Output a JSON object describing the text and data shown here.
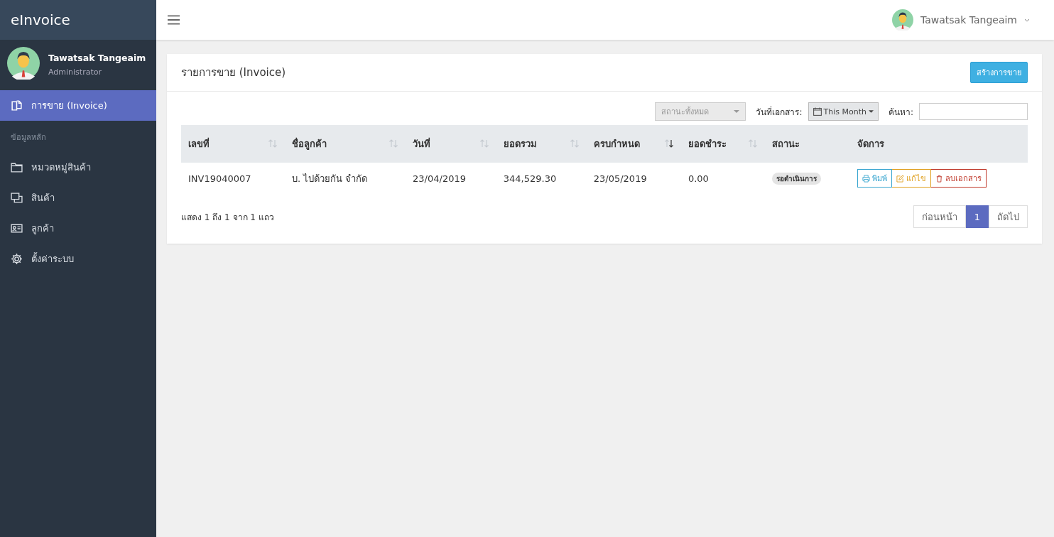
{
  "brand": "eInvoice",
  "user": {
    "name": "Tawatsak Tangeaim",
    "role": "Administrator"
  },
  "sidebar": {
    "items": [
      {
        "kind": "link",
        "label": "การขาย (Invoice)",
        "selected": true
      },
      {
        "kind": "header",
        "label": "ข้อมูลหลัก"
      },
      {
        "kind": "link",
        "label": "หมวดหมู่สินค้า",
        "selected": false
      },
      {
        "kind": "link",
        "label": "สินค้า",
        "selected": false
      },
      {
        "kind": "link",
        "label": "ลูกค้า",
        "selected": false
      },
      {
        "kind": "link",
        "label": "ตั้งค่าระบบ",
        "selected": false
      }
    ]
  },
  "topbar": {
    "user_name": "Tawatsak Tangeaim"
  },
  "panel": {
    "title": "รายการขาย (Invoice)",
    "create_button": "สร้างการขาย",
    "filters": {
      "status_placeholder": "สถานะทั้งหมด",
      "date_label": "วันที่เอกสาร:",
      "date_button": "This Month",
      "search_label": "ค้นหา:"
    },
    "table": {
      "columns": [
        {
          "label": "เลขที่",
          "sortable": true,
          "sorted": false
        },
        {
          "label": "ชื่อลูกค้า",
          "sortable": true,
          "sorted": false
        },
        {
          "label": "วันที่",
          "sortable": true,
          "sorted": false
        },
        {
          "label": "ยอดรวม",
          "sortable": true,
          "sorted": false
        },
        {
          "label": "ครบกำหนด",
          "sortable": true,
          "sorted": true
        },
        {
          "label": "ยอดชำระ",
          "sortable": true,
          "sorted": false
        },
        {
          "label": "สถานะ",
          "sortable": false
        },
        {
          "label": "จัดการ",
          "sortable": false
        }
      ],
      "rows": [
        {
          "cells": [
            "INV19040007",
            "บ. ไปด้วยกัน จำกัด",
            "23/04/2019",
            "344,529.30",
            "23/05/2019",
            "0.00"
          ],
          "status": "รอดำเนินการ",
          "actions": [
            {
              "kind": "print",
              "label": "พิมพ์"
            },
            {
              "kind": "edit",
              "label": "แก้ไข"
            },
            {
              "kind": "delete",
              "label": "ลบเอกสาร"
            }
          ]
        }
      ]
    },
    "info": "แสดง 1 ถึง 1 จาก 1 แถว",
    "pagination": [
      {
        "label": "ก่อนหน้า",
        "selected": false
      },
      {
        "label": "1",
        "selected": true
      },
      {
        "label": "ถัดไป",
        "selected": false
      }
    ]
  }
}
